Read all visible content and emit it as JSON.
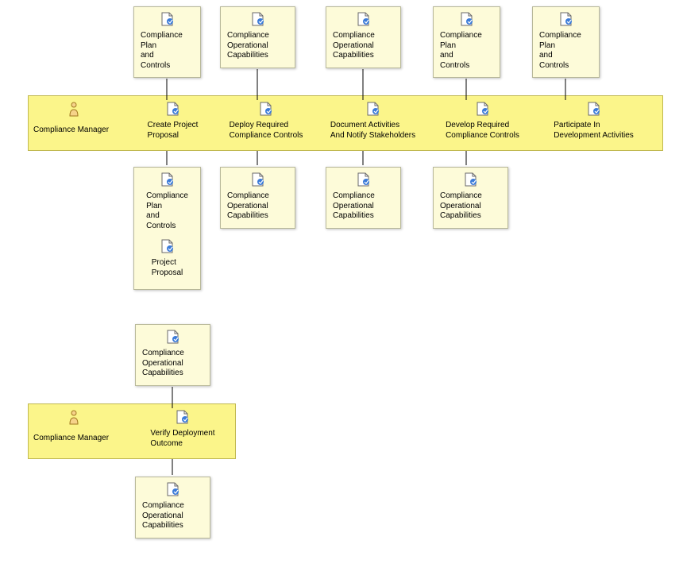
{
  "colors": {
    "boxFill": "#fdfbd9",
    "boxBorder": "#b8b89a",
    "laneFill": "#fbf58a",
    "laneBorder": "#c0b850",
    "arrow": "#000000"
  },
  "top_inputs": [
    {
      "label": "Compliance\nPlan\nand\nControls"
    },
    {
      "label": "Compliance\nOperational\nCapabilities"
    },
    {
      "label": "Compliance\nOperational\nCapabilities"
    },
    {
      "label": "Compliance\nPlan\nand\nControls"
    },
    {
      "label": "Compliance\nPlan\nand\nControls"
    }
  ],
  "lane1": {
    "role": "Compliance Manager",
    "activities": [
      {
        "label": "Create Project\nProposal"
      },
      {
        "label": "Deploy Required\nCompliance Controls"
      },
      {
        "label": "Document Activities\nAnd Notify Stakeholders"
      },
      {
        "label": "Develop Required\nCompliance Controls"
      },
      {
        "label": "Participate In\nDevelopment Activities"
      }
    ]
  },
  "bottom_outputs": [
    {
      "labels": [
        "Compliance\nPlan\nand\nControls",
        "Project\nProposal"
      ]
    },
    {
      "labels": [
        "Compliance\nOperational\nCapabilities"
      ]
    },
    {
      "labels": [
        "Compliance\nOperational\nCapabilities"
      ]
    },
    {
      "labels": [
        "Compliance\nOperational\nCapabilities"
      ]
    }
  ],
  "group2": {
    "top": {
      "label": "Compliance\nOperational\nCapabilities"
    },
    "lane": {
      "role": "Compliance Manager",
      "activity": {
        "label": "Verify Deployment\nOutcome"
      }
    },
    "bottom": {
      "label": "Compliance\nOperational\nCapabilities"
    }
  }
}
